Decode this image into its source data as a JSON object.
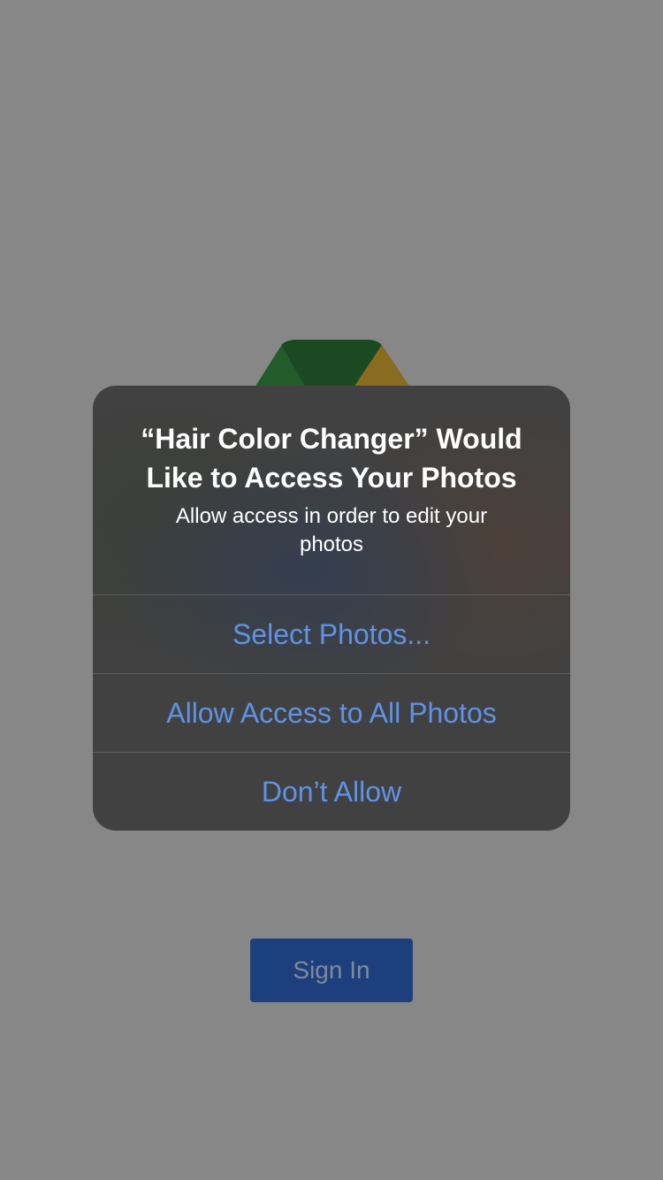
{
  "alert": {
    "title": "“Hair Color Changer” Would Like to Access Your Photos",
    "message": "Allow access in order to edit your photos",
    "actions": [
      {
        "label": "Select Photos..."
      },
      {
        "label": "Allow Access to All Photos"
      },
      {
        "label": "Don’t Allow"
      }
    ],
    "action_color": "#5f93e6"
  },
  "app": {
    "sign_in_label": "Sign In",
    "logo_icon": "app-logo-icon",
    "logo_colors": [
      "#225c2a",
      "#1b4a22",
      "#8a6c20"
    ]
  },
  "colors": {
    "overlay_background": "#878787",
    "alert_background": "#414141",
    "sign_in_background": "#1e3f7d"
  }
}
